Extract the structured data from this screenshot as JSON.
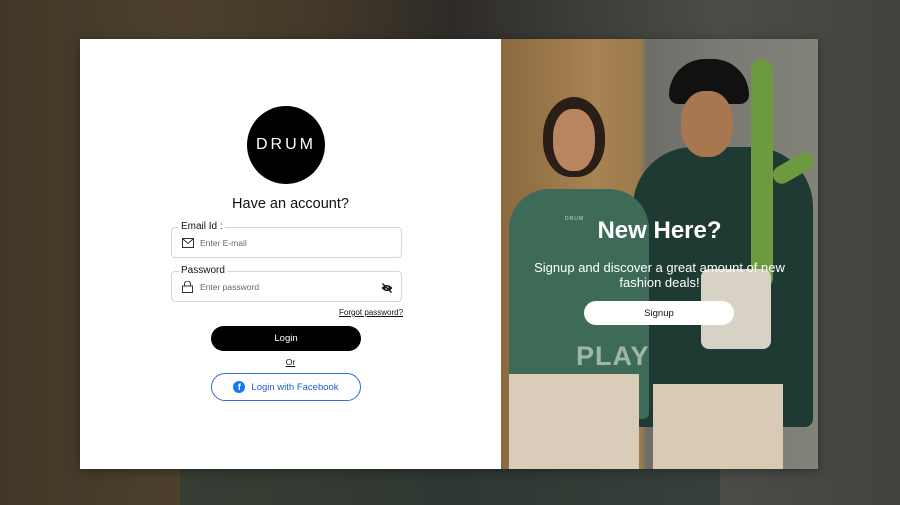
{
  "brand": {
    "logo_text": "DRUM"
  },
  "login": {
    "title": "Have an account?",
    "email_label": "Email Id :",
    "email_placeholder": "Enter E-mail",
    "password_label": "Password",
    "password_placeholder": "Enter password",
    "forgot_link": "Forgot password?",
    "login_button": "Login",
    "or_text": "Or",
    "facebook_button": "Login with Facebook"
  },
  "promo": {
    "heading": "New Here?",
    "subtext": "Signup and discover a great amount of new fashion deals!",
    "signup_button": "Signup",
    "shirt_text": "PLAY",
    "shirt_brand": "DRUM"
  },
  "colors": {
    "primary": "#000000",
    "facebook": "#1877f2",
    "facebook_text": "#1c5fc9"
  },
  "icons": [
    "mail-icon",
    "lock-icon",
    "eye-off-icon",
    "facebook-icon"
  ]
}
